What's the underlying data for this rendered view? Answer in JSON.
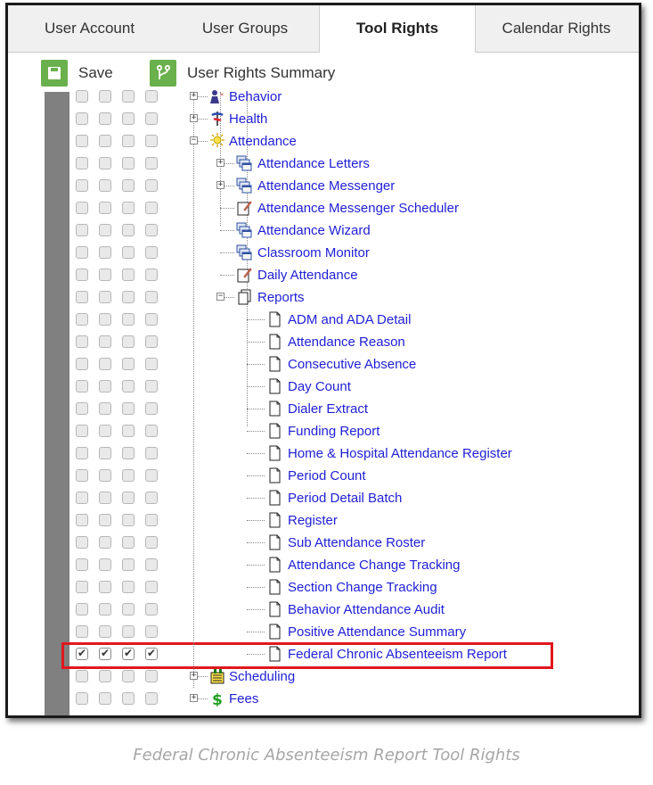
{
  "tabs": [
    {
      "label": "User Account",
      "active": false
    },
    {
      "label": "User Groups",
      "active": false
    },
    {
      "label": "Tool Rights",
      "active": true
    },
    {
      "label": "Calendar Rights",
      "active": false
    }
  ],
  "toolbar": {
    "save_label": "Save",
    "summary_label": "User Rights Summary"
  },
  "tree_rows": [
    {
      "label": "Behavior",
      "icon": "behavior-icon",
      "level": 0,
      "expander": "+",
      "checked": false
    },
    {
      "label": "Health",
      "icon": "health-icon",
      "level": 0,
      "expander": "+",
      "checked": false
    },
    {
      "label": "Attendance",
      "icon": "attendance-icon",
      "level": 0,
      "expander": "-",
      "checked": false
    },
    {
      "label": "Attendance Letters",
      "icon": "window-stack-icon",
      "level": 1,
      "expander": "+",
      "checked": false
    },
    {
      "label": "Attendance Messenger",
      "icon": "window-stack-icon",
      "level": 1,
      "expander": "+",
      "checked": false
    },
    {
      "label": "Attendance Messenger Scheduler",
      "icon": "edit-note-icon",
      "level": 1,
      "expander": "",
      "checked": false
    },
    {
      "label": "Attendance Wizard",
      "icon": "window-stack-icon",
      "level": 1,
      "expander": "",
      "checked": false
    },
    {
      "label": "Classroom Monitor",
      "icon": "window-stack-icon",
      "level": 1,
      "expander": "",
      "checked": false
    },
    {
      "label": "Daily Attendance",
      "icon": "edit-note-icon",
      "level": 1,
      "expander": "",
      "checked": false
    },
    {
      "label": "Reports",
      "icon": "document-stack-icon",
      "level": 1,
      "expander": "-",
      "checked": false
    },
    {
      "label": "ADM and ADA Detail",
      "icon": "document-icon",
      "level": 2,
      "expander": "",
      "checked": false
    },
    {
      "label": "Attendance Reason",
      "icon": "document-icon",
      "level": 2,
      "expander": "",
      "checked": false
    },
    {
      "label": "Consecutive Absence",
      "icon": "document-icon",
      "level": 2,
      "expander": "",
      "checked": false
    },
    {
      "label": "Day Count",
      "icon": "document-icon",
      "level": 2,
      "expander": "",
      "checked": false
    },
    {
      "label": "Dialer Extract",
      "icon": "document-icon",
      "level": 2,
      "expander": "",
      "checked": false
    },
    {
      "label": "Funding Report",
      "icon": "document-icon",
      "level": 2,
      "expander": "",
      "checked": false
    },
    {
      "label": "Home & Hospital Attendance Register",
      "icon": "document-icon",
      "level": 2,
      "expander": "",
      "checked": false
    },
    {
      "label": "Period Count",
      "icon": "document-icon",
      "level": 2,
      "expander": "",
      "checked": false
    },
    {
      "label": "Period Detail Batch",
      "icon": "document-icon",
      "level": 2,
      "expander": "",
      "checked": false
    },
    {
      "label": "Register",
      "icon": "document-icon",
      "level": 2,
      "expander": "",
      "checked": false
    },
    {
      "label": "Sub Attendance Roster",
      "icon": "document-icon",
      "level": 2,
      "expander": "",
      "checked": false
    },
    {
      "label": "Attendance Change Tracking",
      "icon": "document-icon",
      "level": 2,
      "expander": "",
      "checked": false
    },
    {
      "label": "Section Change Tracking",
      "icon": "document-icon",
      "level": 2,
      "expander": "",
      "checked": false
    },
    {
      "label": "Behavior Attendance Audit",
      "icon": "document-icon",
      "level": 2,
      "expander": "",
      "checked": false
    },
    {
      "label": "Positive Attendance Summary",
      "icon": "document-icon",
      "level": 2,
      "expander": "",
      "checked": false
    },
    {
      "label": "Federal Chronic Absenteeism Report",
      "icon": "document-icon",
      "level": 2,
      "expander": "",
      "checked": true
    },
    {
      "label": "Scheduling",
      "icon": "scheduling-icon",
      "level": 0,
      "expander": "+",
      "checked": false
    },
    {
      "label": "Fees",
      "icon": "dollar-icon",
      "level": 0,
      "expander": "+",
      "checked": false
    }
  ],
  "caption": "Federal Chronic Absenteeism Report Tool Rights",
  "colors": {
    "link": "#1f1fd6",
    "toolbar_icon": "#6ab04c",
    "highlight": "#e0181f",
    "gutter": "#808080"
  }
}
